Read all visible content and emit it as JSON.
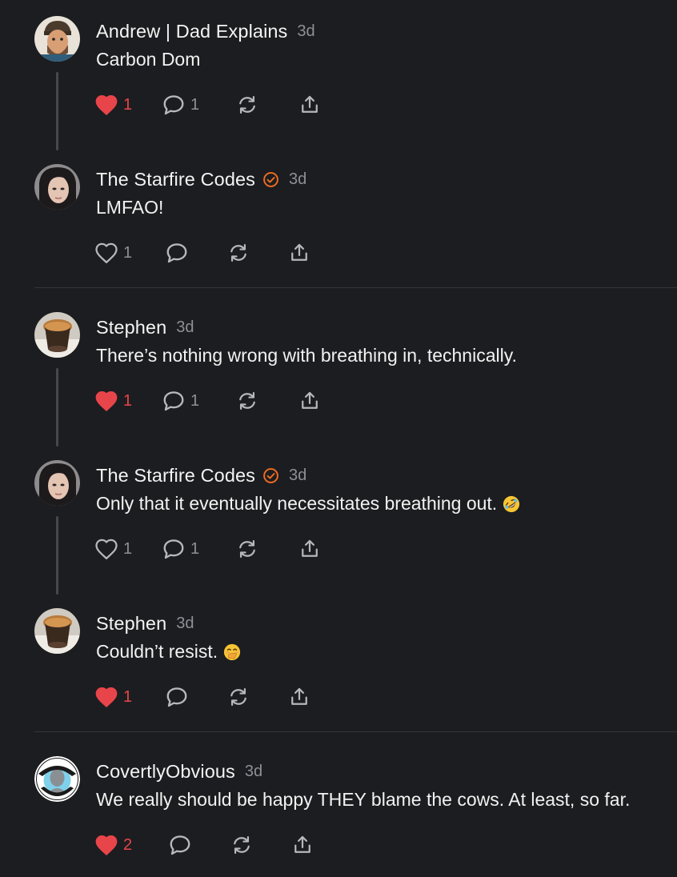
{
  "colors": {
    "background": "#1c1d20",
    "like_red": "#e8454b",
    "verified_orange": "#f26d21",
    "muted": "#8e9095",
    "thread_line": "#46484c"
  },
  "icons": {
    "like": "heart-icon",
    "reply": "speech-bubble-icon",
    "restack": "restack-arrows-icon",
    "share": "share-upload-icon",
    "verified": "verified-check-icon"
  },
  "comments": [
    {
      "author": "Andrew | Dad Explains",
      "time": "3d",
      "text": "Carbon Dom",
      "verified": false,
      "likes": "1",
      "liked": true,
      "replies": "1"
    },
    {
      "author": "The Starfire Codes",
      "time": "3d",
      "text": "LMFAO!",
      "verified": true,
      "likes": "1",
      "liked": false,
      "replies": ""
    },
    {
      "author": "Stephen",
      "time": "3d",
      "text": "There’s nothing wrong with breathing in, technically.",
      "verified": false,
      "likes": "1",
      "liked": true,
      "replies": "1"
    },
    {
      "author": "The Starfire Codes",
      "time": "3d",
      "text": "Only that it eventually necessitates breathing out.",
      "emoji": "rolling-on-floor-laughing-emoji",
      "verified": true,
      "likes": "1",
      "liked": false,
      "replies": "1"
    },
    {
      "author": "Stephen",
      "time": "3d",
      "text": "Couldn’t resist.",
      "emoji": "face-with-hand-over-mouth-emoji",
      "verified": false,
      "likes": "1",
      "liked": true,
      "replies": ""
    },
    {
      "author": "CovertlyObvious",
      "time": "3d",
      "text": "We really should be happy THEY blame the cows. At least, so far.",
      "verified": false,
      "likes": "2",
      "liked": true,
      "replies": ""
    }
  ]
}
